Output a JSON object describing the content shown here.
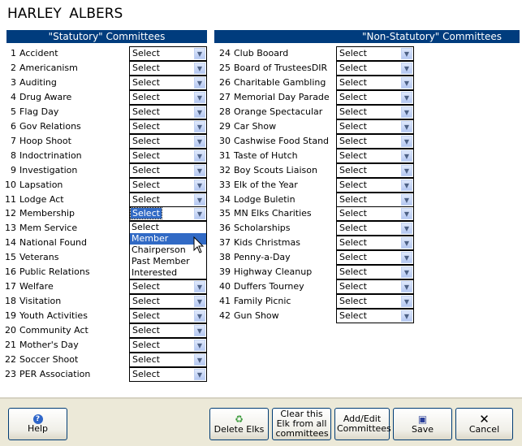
{
  "member_name": "HARLEY  ALBERS",
  "statutory_header": "\"Statutory\" Committees",
  "non_statutory_header": "\"Non-Statutory\" Committees",
  "statutory": [
    {
      "n": "1",
      "name": "Accident",
      "value": "Select"
    },
    {
      "n": "2",
      "name": "Americanism",
      "value": "Select"
    },
    {
      "n": "3",
      "name": "Auditing",
      "value": "Select"
    },
    {
      "n": "4",
      "name": "Drug Aware",
      "value": "Select"
    },
    {
      "n": "5",
      "name": "Flag Day",
      "value": "Select"
    },
    {
      "n": "6",
      "name": "Gov Relations",
      "value": "Select"
    },
    {
      "n": "7",
      "name": "Hoop Shoot",
      "value": "Select"
    },
    {
      "n": "8",
      "name": "Indoctrination",
      "value": "Select"
    },
    {
      "n": "9",
      "name": "Investigation",
      "value": "Select"
    },
    {
      "n": "10",
      "name": "Lapsation",
      "value": "Select"
    },
    {
      "n": "11",
      "name": "Lodge Act",
      "value": "Select"
    },
    {
      "n": "12",
      "name": "Membership",
      "value": "Select"
    },
    {
      "n": "13",
      "name": "Mem Service",
      "value": "Select"
    },
    {
      "n": "14",
      "name": "National Found",
      "value": "Select"
    },
    {
      "n": "15",
      "name": "Veterans",
      "value": "Select"
    },
    {
      "n": "16",
      "name": "Public Relations",
      "value": "Select"
    },
    {
      "n": "17",
      "name": "Welfare",
      "value": "Select"
    },
    {
      "n": "18",
      "name": "Visitation",
      "value": "Select"
    },
    {
      "n": "19",
      "name": "Youth Activities",
      "value": "Select"
    },
    {
      "n": "20",
      "name": "Community Act",
      "value": "Select"
    },
    {
      "n": "21",
      "name": "Mother's Day",
      "value": "Select"
    },
    {
      "n": "22",
      "name": "Soccer Shoot",
      "value": "Select"
    },
    {
      "n": "23",
      "name": "PER Association",
      "value": "Select"
    }
  ],
  "non_statutory": [
    {
      "n": "24",
      "name": "Club Booard",
      "value": "Select"
    },
    {
      "n": "25",
      "name": "Board of TrusteesDIR",
      "value": "Select"
    },
    {
      "n": "26",
      "name": "Charitable Gambling",
      "value": "Select"
    },
    {
      "n": "27",
      "name": "Memorial Day Parade",
      "value": "Select"
    },
    {
      "n": "28",
      "name": "Orange Spectacular",
      "value": "Select"
    },
    {
      "n": "29",
      "name": "Car Show",
      "value": "Select"
    },
    {
      "n": "30",
      "name": "Cashwise Food Stand",
      "value": "Select"
    },
    {
      "n": "31",
      "name": "Taste of Hutch",
      "value": "Select"
    },
    {
      "n": "32",
      "name": "Boy Scouts Liaison",
      "value": "Select"
    },
    {
      "n": "33",
      "name": "Elk of the Year",
      "value": "Select"
    },
    {
      "n": "34",
      "name": "Lodge Buletin",
      "value": "Select"
    },
    {
      "n": "35",
      "name": "MN Elks Charities",
      "value": "Select"
    },
    {
      "n": "36",
      "name": "Scholarships",
      "value": "Select"
    },
    {
      "n": "37",
      "name": "Kids Christmas",
      "value": "Select"
    },
    {
      "n": "38",
      "name": "Penny-a-Day",
      "value": "Select"
    },
    {
      "n": "39",
      "name": "Highway Cleanup",
      "value": "Select"
    },
    {
      "n": "40",
      "name": "Duffers Tourney",
      "value": "Select"
    },
    {
      "n": "41",
      "name": "Family Picnic",
      "value": "Select"
    },
    {
      "n": "42",
      "name": "Gun Show",
      "value": "Select"
    }
  ],
  "open_dropdown": {
    "row": "12",
    "options": [
      "Select",
      "Member",
      "Chairperson",
      "Past Member",
      "Interested"
    ],
    "highlighted": "Member"
  },
  "buttons": {
    "help": "Help",
    "delete": "Delete Elks",
    "clear": "Clear this Elk from all committees",
    "add_edit": "Add/Edit Committees",
    "save": "Save",
    "cancel": "Cancel"
  },
  "colors": {
    "header_bg": "#003C7D",
    "highlight": "#316AC5",
    "bar_bg": "#ECE9D8"
  }
}
